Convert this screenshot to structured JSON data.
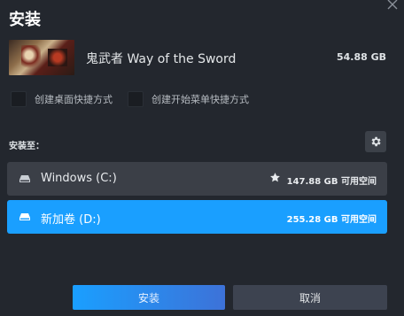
{
  "dialog": {
    "title": "安装"
  },
  "game": {
    "name": "鬼武者 Way of the Sword",
    "size": "54.88 GB"
  },
  "options": [
    {
      "label": "创建桌面快捷方式",
      "checked": false
    },
    {
      "label": "创建开始菜单快捷方式",
      "checked": false
    }
  ],
  "install_to": {
    "label": "安装至："
  },
  "drives": [
    {
      "name": "Windows (C:)",
      "space": "147.88 GB 可用空间",
      "default": true,
      "selected": false
    },
    {
      "name": "新加卷 (D:)",
      "space": "255.28 GB 可用空间",
      "default": false,
      "selected": true
    }
  ],
  "buttons": {
    "install": "安装",
    "cancel": "取消"
  },
  "colors": {
    "accent": "#1a9fff",
    "background": "#23272e",
    "drive_bg": "#3b3f47"
  }
}
